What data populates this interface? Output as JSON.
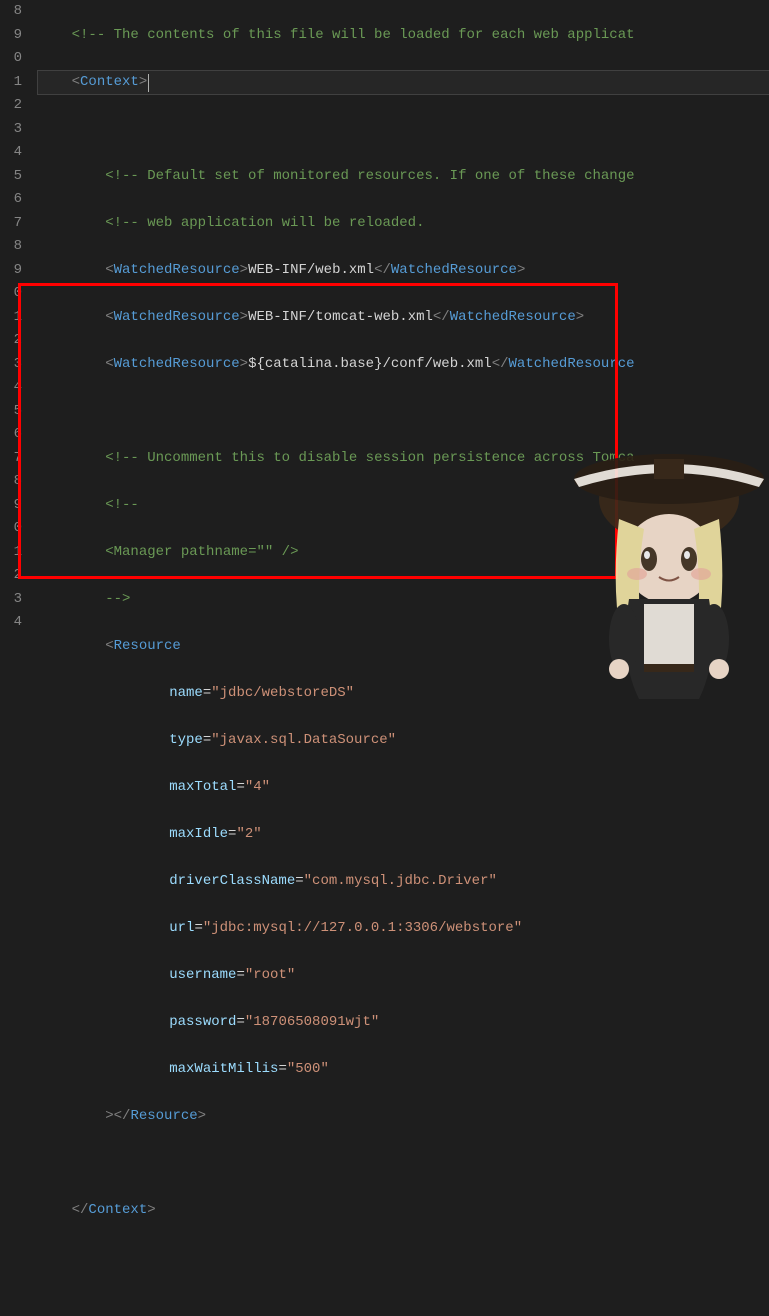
{
  "lineNumbers": [
    "8",
    "9",
    "0",
    "1",
    "2",
    "3",
    "4",
    "5",
    "6",
    "7",
    "8",
    "9",
    "0",
    "1",
    "2",
    "3",
    "4",
    "5",
    "6",
    "7",
    "8",
    "9",
    "0",
    "1",
    "2",
    "3",
    "4"
  ],
  "code": {
    "c0": "<!-- The contents of this file will be loaded for each web applicat",
    "contextOpen": "Context",
    "c_def1": "<!-- Default set of monitored resources. If one of these change",
    "c_def2": "<!-- web application will be reloaded.",
    "wr": "WatchedResource",
    "wr1_text": "WEB-INF/web.xml",
    "wr2_text": "WEB-INF/tomcat-web.xml",
    "wr3_text": "${catalina.base}/conf/web.xml",
    "c_uncomment": "<!-- Uncomment this to disable session persistence across Tomca",
    "c_open": "<!--",
    "mgr_tag": "Manager",
    "mgr_attr": "pathname",
    "mgr_val": "\"\"",
    "c_close": "-->",
    "res": "Resource",
    "attr_name": "name",
    "val_name": "\"jdbc/webstoreDS\"",
    "attr_type": "type",
    "val_type": "\"javax.sql.DataSource\"",
    "attr_maxTotal": "maxTotal",
    "val_maxTotal": "\"4\"",
    "attr_maxIdle": "maxIdle",
    "val_maxIdle": "\"2\"",
    "attr_driverClassName": "driverClassName",
    "val_driverClassName": "\"com.mysql.jdbc.Driver\"",
    "attr_url": "url",
    "val_url": "\"jdbc:mysql://127.0.0.1:3306/webstore\"",
    "attr_username": "username",
    "val_username": "\"root\"",
    "attr_password": "password",
    "val_password": "\"18706508091wjt\"",
    "attr_maxWaitMillis": "maxWaitMillis",
    "val_maxWaitMillis": "\"500\"",
    "eq": "="
  }
}
